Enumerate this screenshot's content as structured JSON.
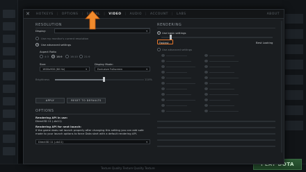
{
  "nav": {
    "tabs": [
      "HOTKEYS",
      "OPTIONS",
      "SOCIAL",
      "VIDEO",
      "AUDIO",
      "ACCOUNT",
      "LABS"
    ],
    "active_tab": "VIDEO",
    "about": "ABOUT"
  },
  "resolution": {
    "heading": "RESOLUTION",
    "display_label": "Display:",
    "use_monitor_label": "Use my monitor's current resolution",
    "use_advanced_label": "Use advanced settings",
    "aspect_ratio_label": "Aspect Ratio",
    "aspect_options": [
      "4:3",
      "16:9",
      "16:10",
      "21:9"
    ],
    "aspect_selected": "16:9",
    "size_label": "Size:",
    "size_value": "1600x900 (60 Hz)",
    "display_mode_label": "Display Mode:",
    "display_mode_value": "Exclusive Fullscreen",
    "brightness_label": "Brightness",
    "brightness_value": "110%",
    "brightness_level": 0.55,
    "apply_label": "APPLY",
    "reset_label": "RESET TO DEFAULTS"
  },
  "options": {
    "heading": "OPTIONS",
    "render_api_label": "Rendering API in use:",
    "render_api_value": "Direct3D 11 (-dx11)",
    "next_launch_label": "Rendering API for next launch:",
    "next_launch_note": "If the game does not launch properly after changing this setting you can add safe mode to your launch options to force Dota start with a default rendering API.",
    "next_launch_value": "Direct3D 11 (-dx11)"
  },
  "rendering": {
    "heading": "RENDERING",
    "use_basic_label": "Use basic settings",
    "fastest_label": "Fastest",
    "best_looking_label": "Best Looking",
    "quality_level": 0.08,
    "use_advanced_label": "Use advanced settings"
  },
  "footer": {
    "play_label": "PLAY DOTA",
    "status_text": "Texture Quality Texture Quality Texture"
  },
  "colors": {
    "highlight": "#e8782a",
    "arrow": "#f08a2c",
    "play": "#2d5a35"
  }
}
